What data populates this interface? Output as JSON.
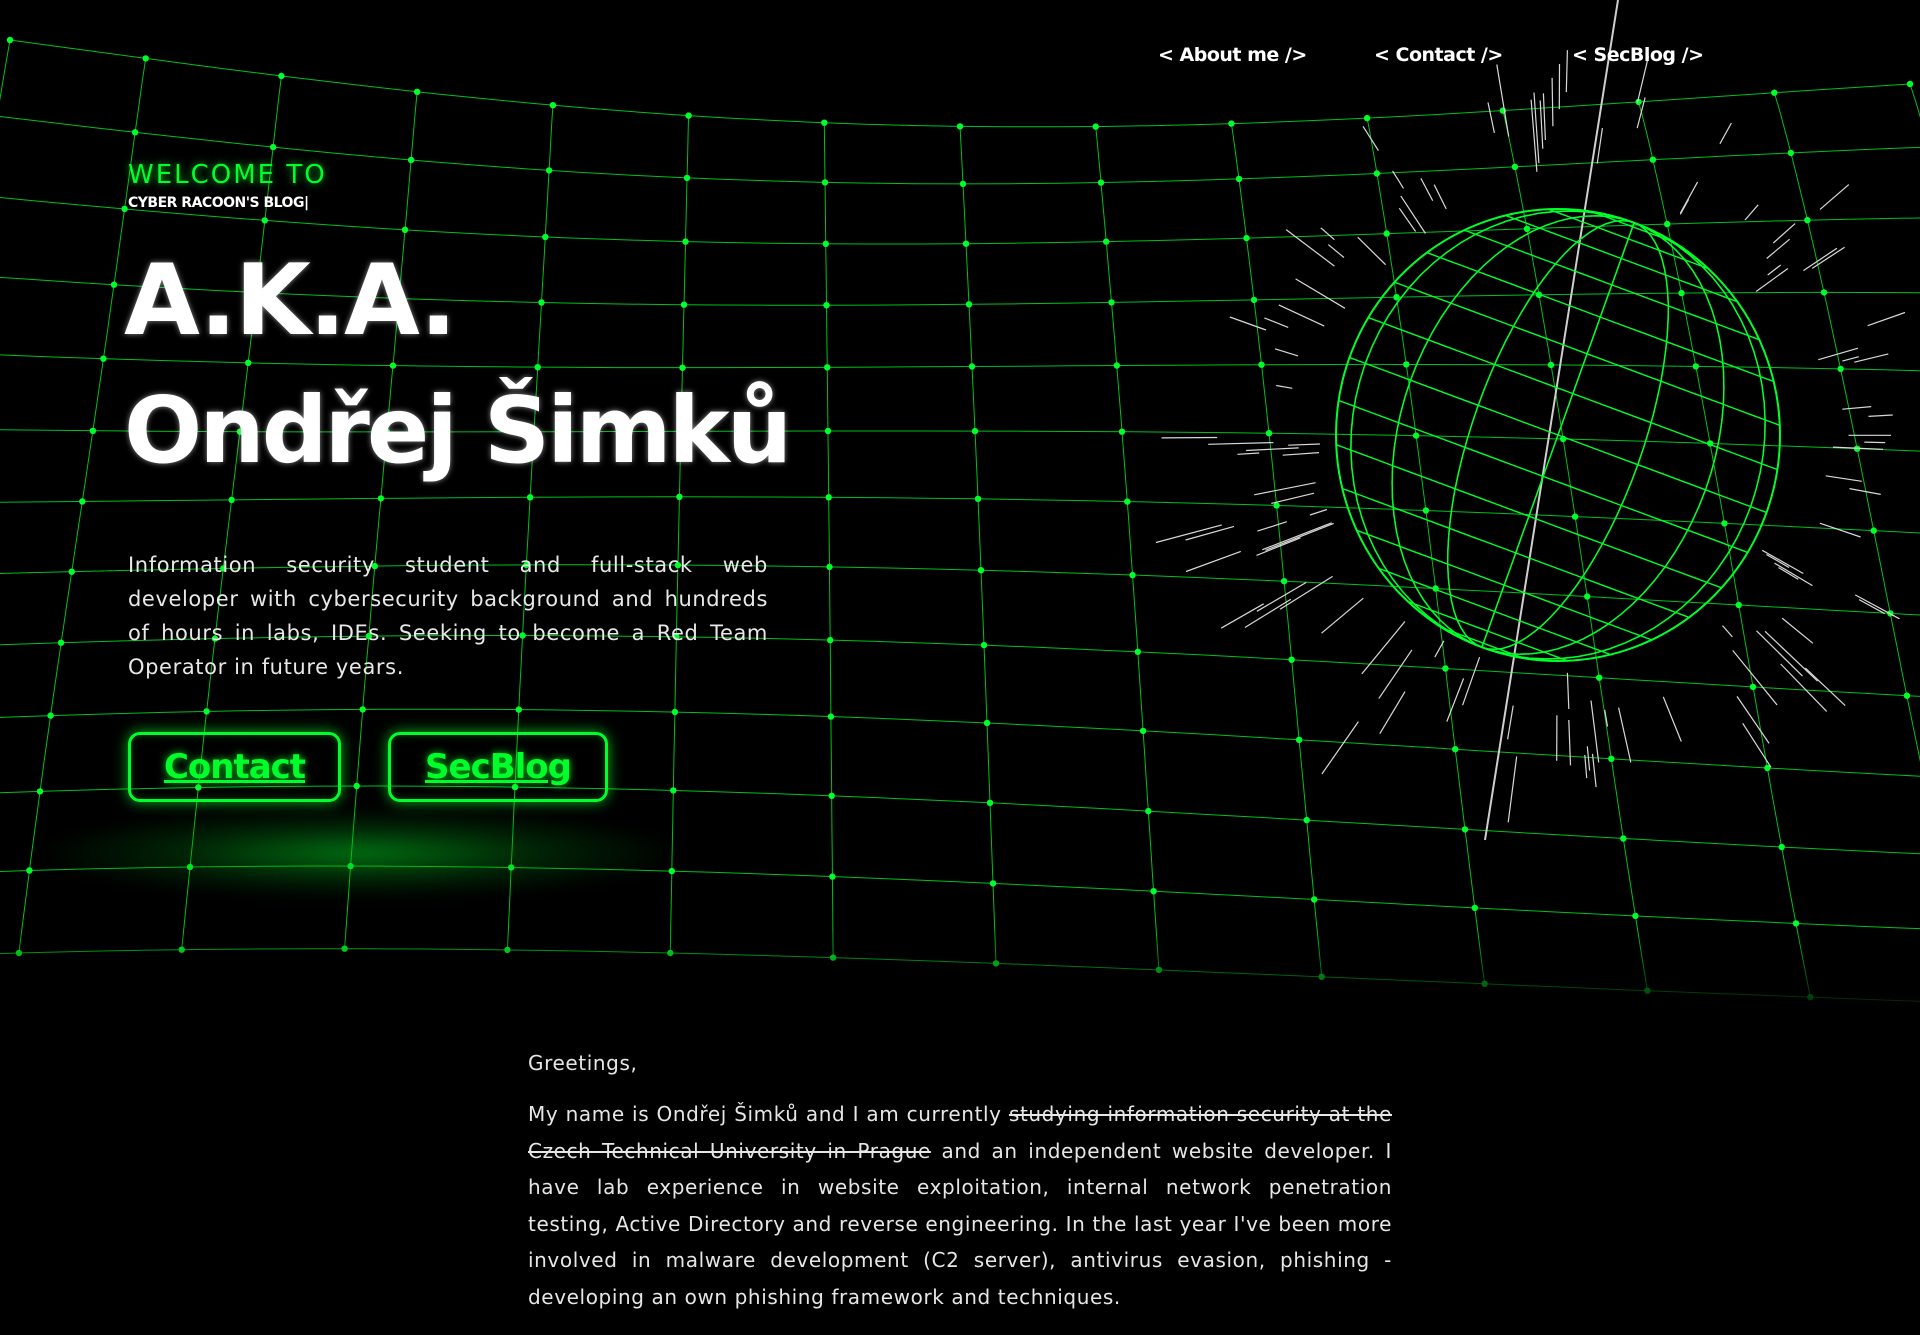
{
  "nav": {
    "items": [
      {
        "label": "< About me />"
      },
      {
        "label": "< Contact />"
      },
      {
        "label": "< SecBlog />"
      }
    ]
  },
  "hero": {
    "welcome": "WELCOME TO",
    "subtitle": "CYBER RACOON'S BLOG|",
    "aka": "A.K.A.",
    "name": "Ondřej Šimků",
    "intro": "Information security student and full-stack web developer with cybersecurity background and hundreds of hours in labs, IDEs. Seeking to become a Red Team Operator in future years.",
    "buttons": {
      "contact": "Contact",
      "secblog": "SecBlog"
    }
  },
  "about": {
    "greeting": "Greetings,",
    "text_before": "My name is Ondřej Šimků and I am currently ",
    "text_struck": "studying information security at the Czech Technical University in Prague",
    "text_after": " and an independent website developer. I have lab experience in website exploitation, internal network penetration testing, Active Directory and reverse engineering. In the last year I've been more involved in malware development (C2 server), antivirus evasion, phishing - developing an own phishing framework and techniques."
  },
  "colors": {
    "background": "#000000",
    "accent": "#00ff2a",
    "text": "#ffffff",
    "body_text": "#e6e6e6"
  },
  "icons": {
    "background": "wireframe-grid-mesh",
    "decoration": "wireframe-sphere-icon"
  }
}
